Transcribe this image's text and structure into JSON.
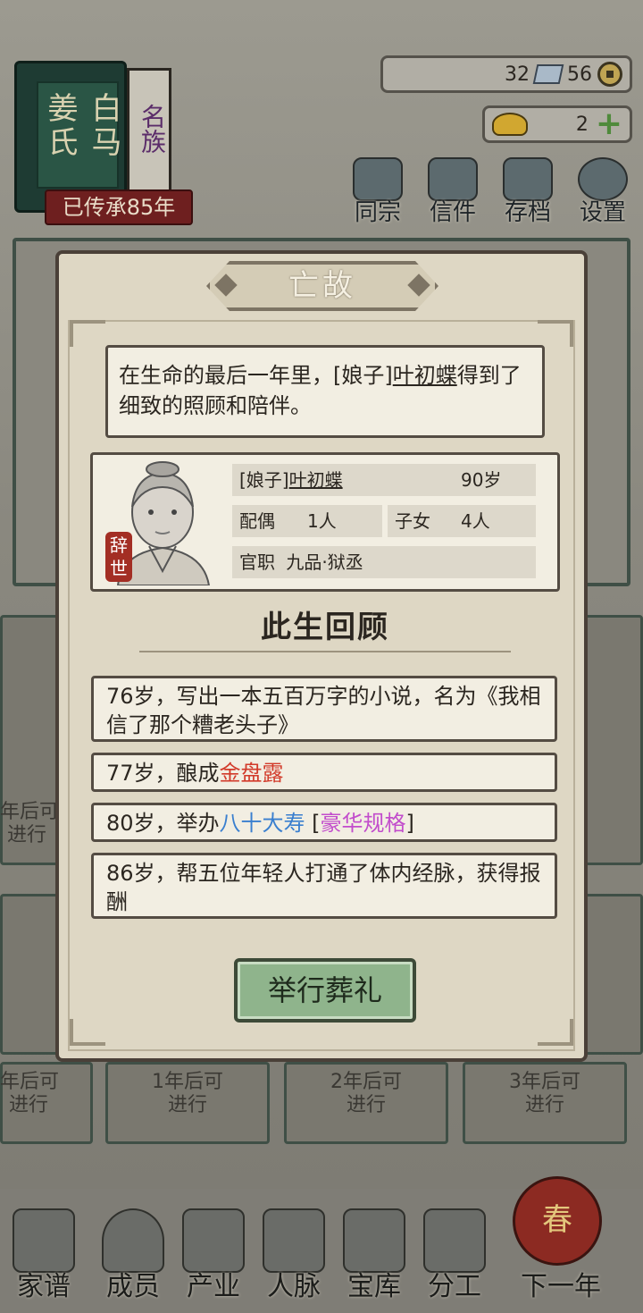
{
  "clan": {
    "name_left": "白马",
    "name_right": "姜氏",
    "tag": "名族",
    "inherit": "已传承85年"
  },
  "resources": {
    "gem_count": "32",
    "coin_count": "56",
    "gold_count": "2"
  },
  "top_menu": [
    {
      "label": "同宗"
    },
    {
      "label": "信件"
    },
    {
      "label": "存档"
    },
    {
      "label": "设置"
    }
  ],
  "background": {
    "left_mid": "年后可\n进行",
    "bottom_cards": [
      {
        "text": "年后可\n进行"
      },
      {
        "text": "1年后可\n进行"
      },
      {
        "text": "2年后可\n进行"
      },
      {
        "text": "3年后可\n进行"
      }
    ]
  },
  "dialog": {
    "title": "亡故",
    "message_part1": "在生命的最后一年里，[娘子]",
    "message_name": "叶初蝶",
    "message_part2": "得到了细致的照顾和陪伴。",
    "profile": {
      "title_prefix": "[娘子]",
      "name": "叶初蝶",
      "age": "90岁",
      "spouse_label": "配偶",
      "spouse_value": "1人",
      "children_label": "子女",
      "children_value": "4人",
      "office_label": "官职",
      "office_value": "九品·狱丞",
      "seal": "辞世"
    },
    "review_title": "此生回顾",
    "events": {
      "e1": "76岁，写出一本五百万字的小说，名为《我相信了那个糟老头子》",
      "e2_prefix": "77岁，酿成",
      "e2_item": "金盘露",
      "e3_prefix": "80岁，举办",
      "e3_item": "八十大寿",
      "e3_bracket_open": " [",
      "e3_grade": "豪华规格",
      "e3_bracket_close": "]",
      "e4": "86岁，帮五位年轻人打通了体内经脉，获得报酬"
    },
    "funeral_button": "举行葬礼"
  },
  "bottom_nav": [
    {
      "label": "家谱"
    },
    {
      "label": "成员"
    },
    {
      "label": "产业"
    },
    {
      "label": "人脉"
    },
    {
      "label": "宝库"
    },
    {
      "label": "分工"
    },
    {
      "label": "下一年"
    }
  ],
  "lantern_text": "春",
  "colors": {
    "highlight_red": "#d23a2a",
    "highlight_blue": "#3a7fcf",
    "highlight_purple": "#c24dcc",
    "button_green": "#8fb48c"
  }
}
